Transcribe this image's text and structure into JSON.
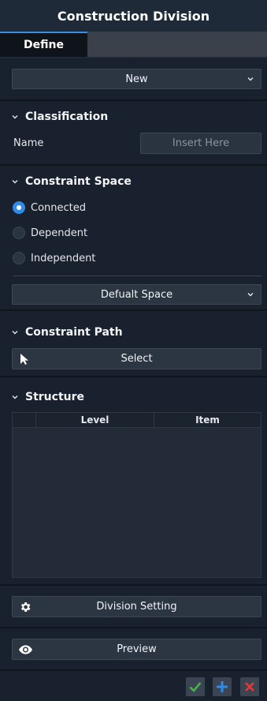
{
  "window": {
    "title": "Construction Division"
  },
  "tabs": [
    {
      "label": "Define"
    }
  ],
  "mode_select": {
    "value": "New"
  },
  "classification": {
    "heading": "Classification",
    "name_label": "Name",
    "name_placeholder": "Insert Here"
  },
  "constraint_space": {
    "heading": "Constraint Space",
    "options": [
      {
        "label": "Connected",
        "selected": true
      },
      {
        "label": "Dependent",
        "selected": false
      },
      {
        "label": "Independent",
        "selected": false
      }
    ],
    "space_select": {
      "value": "Defualt Space"
    }
  },
  "constraint_path": {
    "heading": "Constraint Path",
    "select_label": "Select"
  },
  "structure": {
    "heading": "Structure",
    "columns": [
      "",
      "Level",
      "Item"
    ],
    "rows": []
  },
  "actions": {
    "division_setting": "Division Setting",
    "preview": "Preview"
  },
  "colors": {
    "accent": "#2f8be6",
    "confirm": "#4caf50",
    "add": "#2f8be6",
    "cancel": "#e53935"
  }
}
